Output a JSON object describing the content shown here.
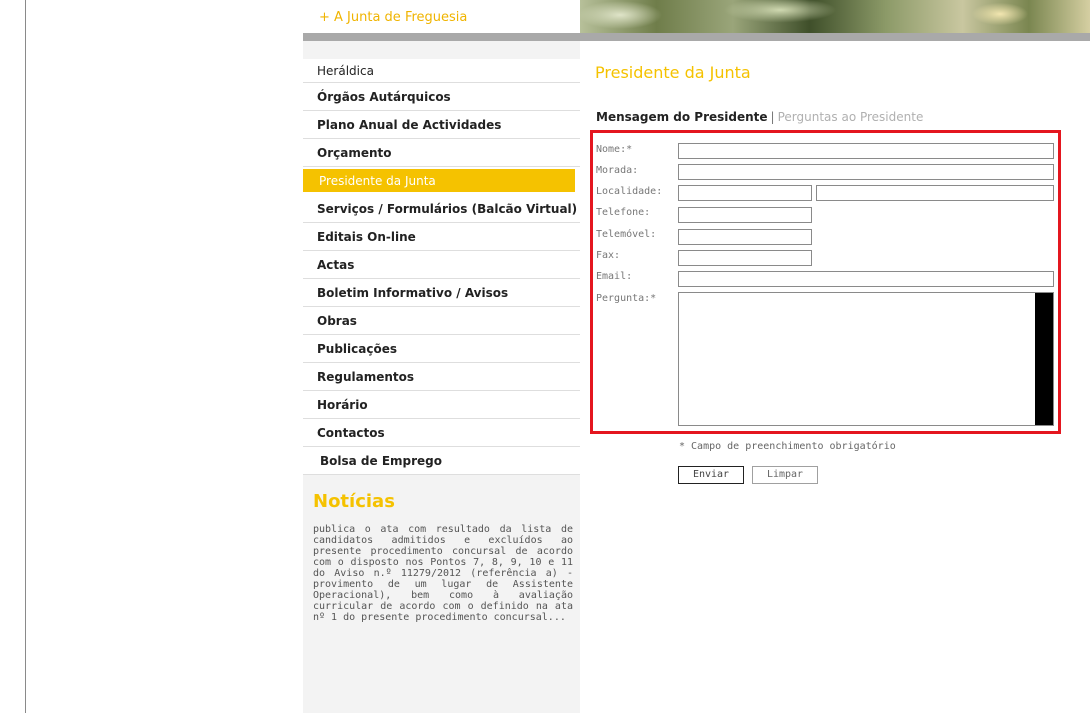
{
  "header": {
    "title": "+ A Junta de Freguesia"
  },
  "sidebar": {
    "items": [
      {
        "label": "Heráldica"
      },
      {
        "label": "Órgãos Autárquicos"
      },
      {
        "label": "Plano Anual de Actividades"
      },
      {
        "label": "Orçamento"
      },
      {
        "label": "Presidente da Junta",
        "active": true
      },
      {
        "label": "Serviços / Formulários (Balcão Virtual)"
      },
      {
        "label": "Editais On-line"
      },
      {
        "label": "Actas"
      },
      {
        "label": "Boletim Informativo / Avisos"
      },
      {
        "label": "Obras"
      },
      {
        "label": "Publicações"
      },
      {
        "label": "Regulamentos"
      },
      {
        "label": "Horário"
      },
      {
        "label": "Contactos"
      },
      {
        "label": "Bolsa de Emprego"
      }
    ]
  },
  "news": {
    "title": "Notícias",
    "text": "publica o ata com resultado da lista de candidatos admitidos e excluídos ao presente procedimento concursal de acordo com o disposto nos Pontos 7, 8, 9, 10 e 11 do Aviso n.º 11279/2012 (referência a) - provimento de um lugar de Assistente Operacional), bem como à avaliação curricular de acordo com o definido na ata nº 1 do presente procedimento concursal..."
  },
  "main": {
    "title": "Presidente da Junta",
    "subnav": {
      "current": "Mensagem do Presidente",
      "separator": "|",
      "other": "Perguntas ao Presidente"
    },
    "form": {
      "fields": {
        "nome": "Nome:*",
        "morada": "Morada:",
        "localidade": "Localidade:",
        "telefone": "Telefone:",
        "telemovel": "Telemóvel:",
        "fax": "Fax:",
        "email": "Email:",
        "pergunta": "Pergunta:*"
      },
      "required_note": "* Campo de preenchimento obrigatório",
      "submit_label": "Enviar",
      "reset_label": "Limpar"
    }
  },
  "colors": {
    "accent": "#f5c200",
    "highlight_border": "#e4161f"
  }
}
